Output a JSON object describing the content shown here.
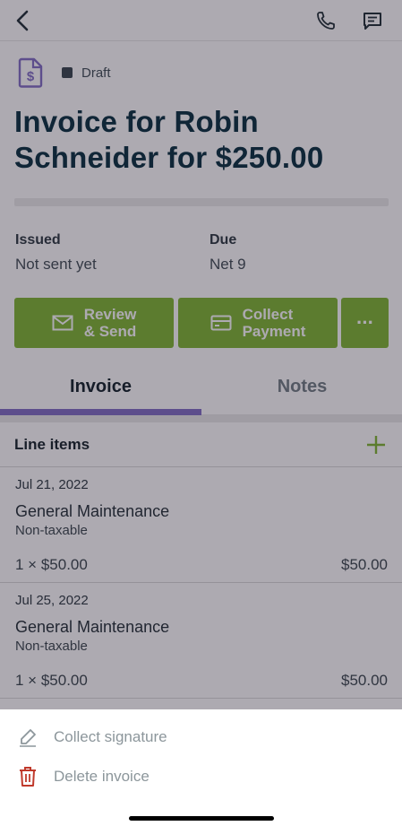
{
  "header": {
    "back_icon": "chevron-left-icon",
    "phone_icon": "phone-icon",
    "message_icon": "message-icon"
  },
  "invoice": {
    "status": "Draft",
    "title": "Invoice for Robin Schneider for $250.00",
    "issued_label": "Issued",
    "issued_value": "Not sent yet",
    "due_label": "Due",
    "due_value": "Net 9"
  },
  "actions": {
    "review_send": [
      "Review",
      "& Send"
    ],
    "collect_payment": [
      "Collect",
      "Payment"
    ],
    "more_label": "···"
  },
  "tabs": [
    {
      "label": "Invoice",
      "active": true
    },
    {
      "label": "Notes",
      "active": false
    }
  ],
  "line_items": {
    "section_title": "Line items",
    "items": [
      {
        "date": "Jul 21, 2022",
        "name": "General Maintenance",
        "tax": "Non-taxable",
        "qty": "1 × $50.00",
        "total": "$50.00"
      },
      {
        "date": "Jul 25, 2022",
        "name": "General Maintenance",
        "tax": "Non-taxable",
        "qty": "1 × $50.00",
        "total": "$50.00"
      }
    ]
  },
  "sheet": {
    "collect_signature": "Collect signature",
    "delete_invoice": "Delete invoice"
  },
  "colors": {
    "brand_green": "#7db52e",
    "accent_purple": "#7f6bc4",
    "danger_red": "#c0392b",
    "title_navy": "#032a3a"
  }
}
